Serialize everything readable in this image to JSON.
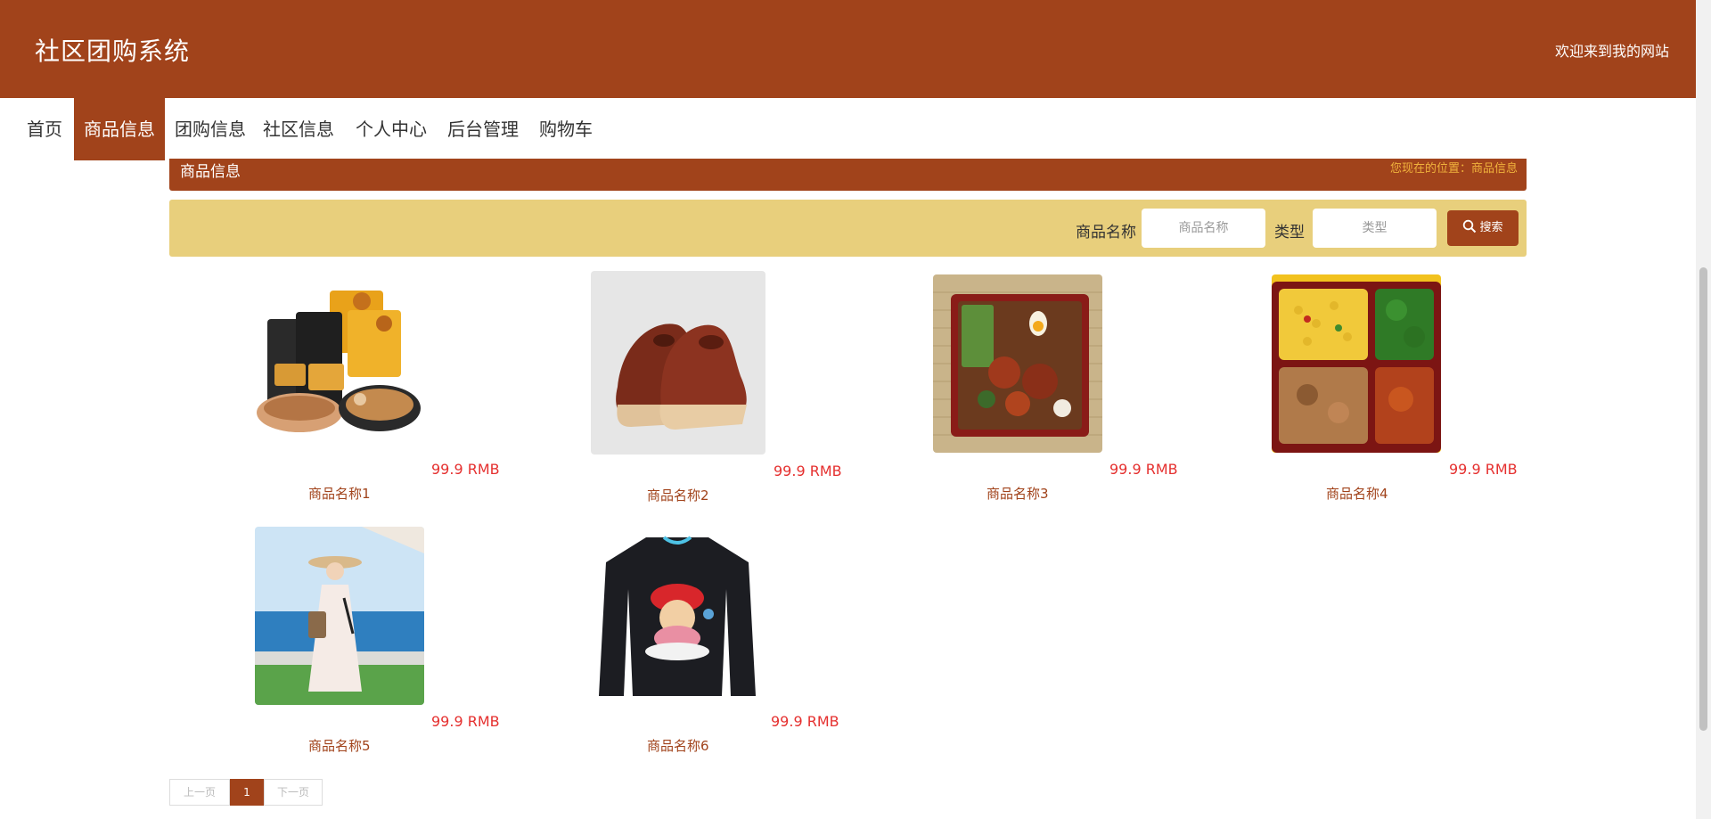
{
  "header": {
    "title": "社区团购系统",
    "welcome": "欢迎来到我的网站"
  },
  "nav": {
    "items": [
      {
        "label": "首页"
      },
      {
        "label": "商品信息"
      },
      {
        "label": "团购信息"
      },
      {
        "label": "社区信息"
      },
      {
        "label": "个人中心"
      },
      {
        "label": "后台管理"
      },
      {
        "label": "购物车"
      }
    ],
    "active_index": 1
  },
  "breadcrumb": {
    "title": "商品信息",
    "location": "您现在的位置：商品信息"
  },
  "search": {
    "name_label": "商品名称",
    "name_placeholder": "商品名称",
    "type_label": "类型",
    "type_placeholder": "类型",
    "button_label": "搜索",
    "button_icon": "search-icon"
  },
  "products": [
    {
      "name": "商品名称1",
      "price": "99.9 RMB",
      "image": "snack-packages"
    },
    {
      "name": "商品名称2",
      "price": "99.9 RMB",
      "image": "brown-leather-shoes"
    },
    {
      "name": "商品名称3",
      "price": "99.9 RMB",
      "image": "bento-box-meal"
    },
    {
      "name": "商品名称4",
      "price": "99.9 RMB",
      "image": "compartment-lunch-box"
    },
    {
      "name": "商品名称5",
      "price": "99.9 RMB",
      "image": "woman-in-white-dress"
    },
    {
      "name": "商品名称6",
      "price": "99.9 RMB",
      "image": "black-graphic-sweatshirt"
    }
  ],
  "pagination": {
    "prev": "上一页",
    "current": "1",
    "next": "下一页"
  },
  "colors": {
    "primary": "#a1431b",
    "search_bg": "#e8cf7c",
    "price": "#e5302f",
    "location_text": "#f0b23c"
  }
}
